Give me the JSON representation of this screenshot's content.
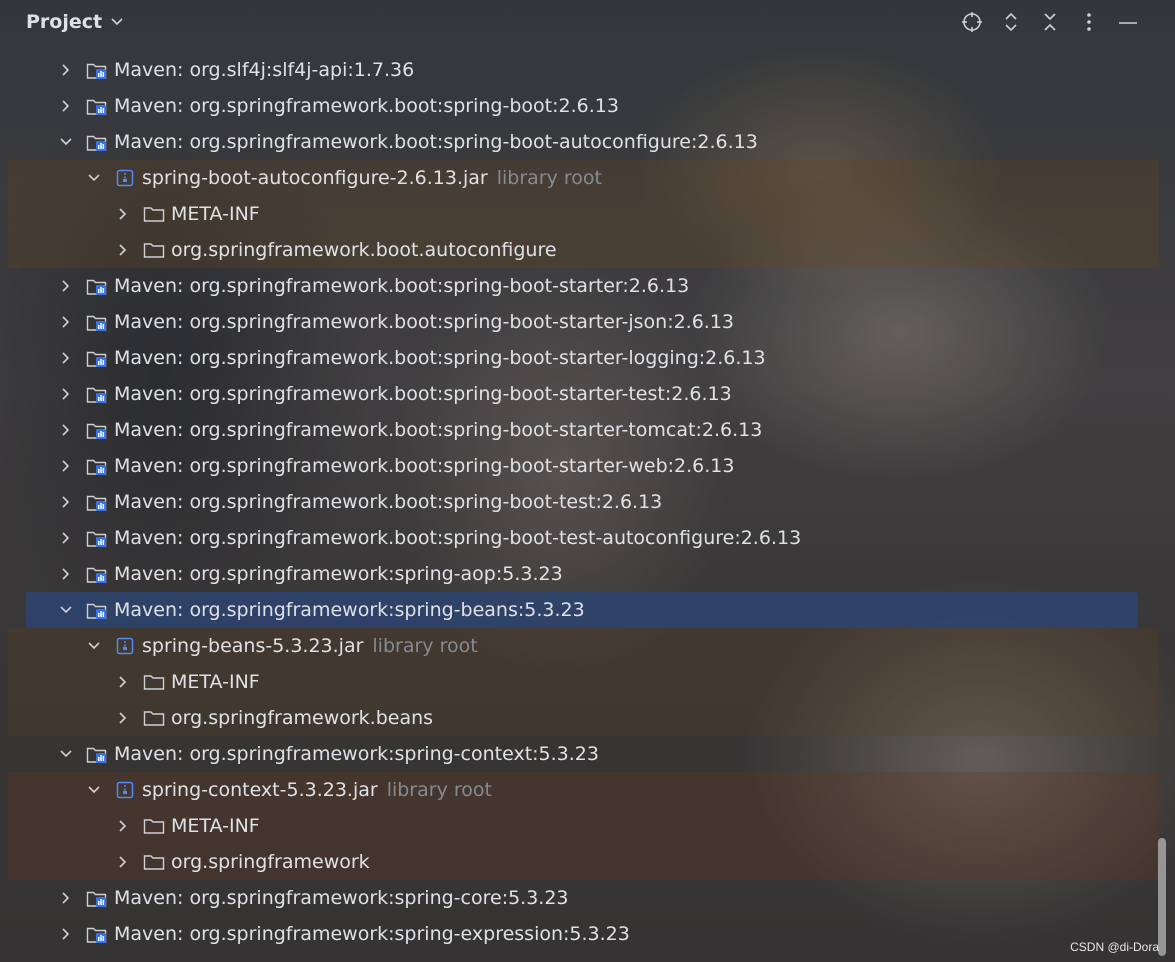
{
  "panel": {
    "title": "Project"
  },
  "toolbar": {
    "locate": "crosshair-icon",
    "expand": "expand-all-icon",
    "collapse": "collapse-all-icon",
    "options": "more-vertical-icon",
    "hide": "minimize-icon"
  },
  "tree": [
    {
      "level": 0,
      "expanded": false,
      "type": "library",
      "label": "Maven: org.slf4j:slf4j-api:1.7.36"
    },
    {
      "level": 0,
      "expanded": false,
      "type": "library",
      "label": "Maven: org.springframework.boot:spring-boot:2.6.13"
    },
    {
      "level": 0,
      "expanded": true,
      "type": "library",
      "label": "Maven: org.springframework.boot:spring-boot-autoconfigure:2.6.13"
    },
    {
      "level": 1,
      "expanded": true,
      "type": "jar",
      "label": "spring-boot-autoconfigure-2.6.13.jar",
      "hint": "library root"
    },
    {
      "level": 2,
      "expanded": false,
      "type": "folder",
      "label": "META-INF"
    },
    {
      "level": 2,
      "expanded": false,
      "type": "folder",
      "label": "org.springframework.boot.autoconfigure"
    },
    {
      "level": 0,
      "expanded": false,
      "type": "library",
      "label": "Maven: org.springframework.boot:spring-boot-starter:2.6.13"
    },
    {
      "level": 0,
      "expanded": false,
      "type": "library",
      "label": "Maven: org.springframework.boot:spring-boot-starter-json:2.6.13"
    },
    {
      "level": 0,
      "expanded": false,
      "type": "library",
      "label": "Maven: org.springframework.boot:spring-boot-starter-logging:2.6.13"
    },
    {
      "level": 0,
      "expanded": false,
      "type": "library",
      "label": "Maven: org.springframework.boot:spring-boot-starter-test:2.6.13"
    },
    {
      "level": 0,
      "expanded": false,
      "type": "library",
      "label": "Maven: org.springframework.boot:spring-boot-starter-tomcat:2.6.13"
    },
    {
      "level": 0,
      "expanded": false,
      "type": "library",
      "label": "Maven: org.springframework.boot:spring-boot-starter-web:2.6.13"
    },
    {
      "level": 0,
      "expanded": false,
      "type": "library",
      "label": "Maven: org.springframework.boot:spring-boot-test:2.6.13"
    },
    {
      "level": 0,
      "expanded": false,
      "type": "library",
      "label": "Maven: org.springframework.boot:spring-boot-test-autoconfigure:2.6.13"
    },
    {
      "level": 0,
      "expanded": false,
      "type": "library",
      "label": "Maven: org.springframework:spring-aop:5.3.23"
    },
    {
      "level": 0,
      "expanded": true,
      "type": "library",
      "label": "Maven: org.springframework:spring-beans:5.3.23",
      "selected": true
    },
    {
      "level": 1,
      "expanded": true,
      "type": "jar",
      "label": "spring-beans-5.3.23.jar",
      "hint": "library root"
    },
    {
      "level": 2,
      "expanded": false,
      "type": "folder",
      "label": "META-INF"
    },
    {
      "level": 2,
      "expanded": false,
      "type": "folder",
      "label": "org.springframework.beans"
    },
    {
      "level": 0,
      "expanded": true,
      "type": "library",
      "label": "Maven: org.springframework:spring-context:5.3.23"
    },
    {
      "level": 1,
      "expanded": true,
      "type": "jar",
      "label": "spring-context-5.3.23.jar",
      "hint": "library root"
    },
    {
      "level": 2,
      "expanded": false,
      "type": "folder",
      "label": "META-INF"
    },
    {
      "level": 2,
      "expanded": false,
      "type": "folder",
      "label": "org.springframework"
    },
    {
      "level": 0,
      "expanded": false,
      "type": "library",
      "label": "Maven: org.springframework:spring-core:5.3.23"
    },
    {
      "level": 0,
      "expanded": false,
      "type": "library",
      "label": "Maven: org.springframework:spring-expression:5.3.23"
    }
  ],
  "watermark": "CSDN @di-Dora",
  "colors": {
    "selection": "#2e436e",
    "text": "#dfe1e5",
    "hint": "#868a91",
    "library_icon": "#3574f0",
    "jar_icon": "#548af7"
  }
}
